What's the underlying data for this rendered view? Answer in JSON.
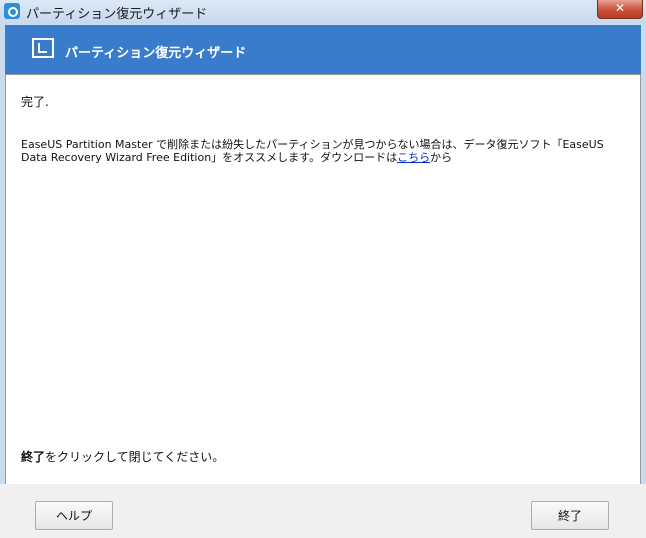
{
  "window": {
    "title": "パーティション復元ウィザード",
    "close_label": "✕"
  },
  "header": {
    "title": "パーティション復元ウィザード"
  },
  "content": {
    "done_label": "完了.",
    "message_before": "EaseUS Partition Master で削除または紛失したパーティションが見つからない場合は、データ復元ソフト「EaseUS Data Recovery Wizard Free Edition」をオススメします。ダウンロードは",
    "message_link": "こちら",
    "message_after": "から",
    "instruction_bold": "終了",
    "instruction_rest": "をクリックして閉じてください。"
  },
  "footer": {
    "help_label": "ヘルプ",
    "finish_label": "終了"
  }
}
